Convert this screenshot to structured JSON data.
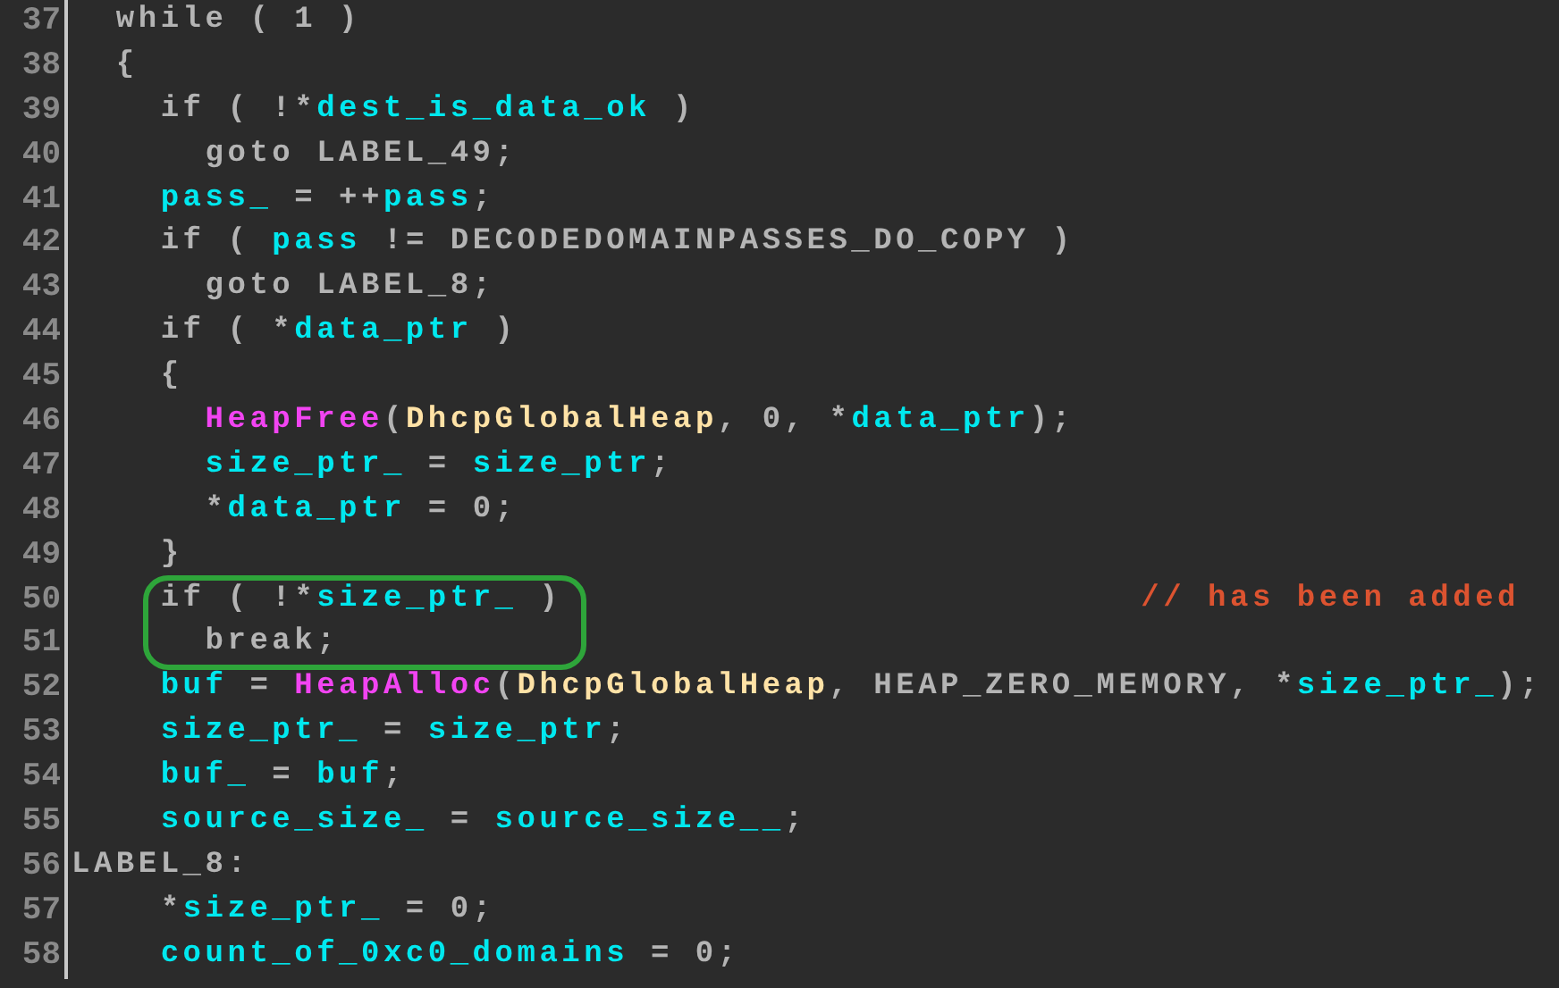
{
  "code_view": {
    "lines": [
      {
        "number": "37",
        "circled": false,
        "tokens": [
          {
            "kind": "plain",
            "text": "  while ( 1 )"
          }
        ]
      },
      {
        "number": "38",
        "circled": false,
        "tokens": [
          {
            "kind": "plain",
            "text": "  {"
          }
        ]
      },
      {
        "number": "39",
        "circled": false,
        "tokens": [
          {
            "kind": "plain",
            "text": "    if ( !*"
          },
          {
            "kind": "variable",
            "text": "dest_is_data_ok"
          },
          {
            "kind": "plain",
            "text": " )"
          }
        ]
      },
      {
        "number": "40",
        "circled": false,
        "tokens": [
          {
            "kind": "plain",
            "text": "      goto LABEL_49;"
          }
        ]
      },
      {
        "number": "41",
        "circled": false,
        "tokens": [
          {
            "kind": "variable",
            "text": "    pass_"
          },
          {
            "kind": "plain",
            "text": " = ++"
          },
          {
            "kind": "variable",
            "text": "pass"
          },
          {
            "kind": "plain",
            "text": ";"
          }
        ]
      },
      {
        "number": "42",
        "circled": false,
        "tokens": [
          {
            "kind": "plain",
            "text": "    if ( "
          },
          {
            "kind": "variable",
            "text": "pass"
          },
          {
            "kind": "plain",
            "text": " != DECODEDOMAINPASSES_DO_COPY )"
          }
        ]
      },
      {
        "number": "43",
        "circled": false,
        "tokens": [
          {
            "kind": "plain",
            "text": "      goto LABEL_8;"
          }
        ]
      },
      {
        "number": "44",
        "circled": false,
        "tokens": [
          {
            "kind": "plain",
            "text": "    if ( *"
          },
          {
            "kind": "variable",
            "text": "data_ptr"
          },
          {
            "kind": "plain",
            "text": " )"
          }
        ]
      },
      {
        "number": "45",
        "circled": false,
        "tokens": [
          {
            "kind": "plain",
            "text": "    {"
          }
        ]
      },
      {
        "number": "46",
        "circled": false,
        "tokens": [
          {
            "kind": "function",
            "text": "      HeapFree"
          },
          {
            "kind": "plain",
            "text": "("
          },
          {
            "kind": "global",
            "text": "DhcpGlobalHeap"
          },
          {
            "kind": "plain",
            "text": ", 0, *"
          },
          {
            "kind": "variable",
            "text": "data_ptr"
          },
          {
            "kind": "plain",
            "text": ");"
          }
        ]
      },
      {
        "number": "47",
        "circled": false,
        "tokens": [
          {
            "kind": "variable",
            "text": "      size_ptr_"
          },
          {
            "kind": "plain",
            "text": " = "
          },
          {
            "kind": "variable",
            "text": "size_ptr"
          },
          {
            "kind": "plain",
            "text": ";"
          }
        ]
      },
      {
        "number": "48",
        "circled": false,
        "tokens": [
          {
            "kind": "plain",
            "text": "      *"
          },
          {
            "kind": "variable",
            "text": "data_ptr"
          },
          {
            "kind": "plain",
            "text": " = 0;"
          }
        ]
      },
      {
        "number": "49",
        "circled": false,
        "tokens": [
          {
            "kind": "plain",
            "text": "    }"
          }
        ]
      },
      {
        "number": "50",
        "circled": true,
        "comment": "// has been added",
        "tokens": [
          {
            "kind": "plain",
            "text": "    if ( !*"
          },
          {
            "kind": "variable",
            "text": "size_ptr_"
          },
          {
            "kind": "plain",
            "text": " )"
          }
        ]
      },
      {
        "number": "51",
        "circled": true,
        "tokens": [
          {
            "kind": "plain",
            "text": "      break;"
          }
        ]
      },
      {
        "number": "52",
        "circled": false,
        "tokens": [
          {
            "kind": "variable",
            "text": "    buf"
          },
          {
            "kind": "plain",
            "text": " = "
          },
          {
            "kind": "function",
            "text": "HeapAlloc"
          },
          {
            "kind": "plain",
            "text": "("
          },
          {
            "kind": "global",
            "text": "DhcpGlobalHeap"
          },
          {
            "kind": "plain",
            "text": ", HEAP_ZERO_MEMORY, *"
          },
          {
            "kind": "variable",
            "text": "size_ptr_"
          },
          {
            "kind": "plain",
            "text": ");"
          }
        ]
      },
      {
        "number": "53",
        "circled": false,
        "tokens": [
          {
            "kind": "variable",
            "text": "    size_ptr_"
          },
          {
            "kind": "plain",
            "text": " = "
          },
          {
            "kind": "variable",
            "text": "size_ptr"
          },
          {
            "kind": "plain",
            "text": ";"
          }
        ]
      },
      {
        "number": "54",
        "circled": false,
        "tokens": [
          {
            "kind": "variable",
            "text": "    buf_"
          },
          {
            "kind": "plain",
            "text": " = "
          },
          {
            "kind": "variable",
            "text": "buf"
          },
          {
            "kind": "plain",
            "text": ";"
          }
        ]
      },
      {
        "number": "55",
        "circled": false,
        "tokens": [
          {
            "kind": "variable",
            "text": "    source_size_"
          },
          {
            "kind": "plain",
            "text": " = "
          },
          {
            "kind": "variable",
            "text": "source_size__"
          },
          {
            "kind": "plain",
            "text": ";"
          }
        ]
      },
      {
        "number": "56",
        "circled": false,
        "tokens": [
          {
            "kind": "plain",
            "text": "LABEL_8:"
          }
        ]
      },
      {
        "number": "57",
        "circled": false,
        "tokens": [
          {
            "kind": "plain",
            "text": "    *"
          },
          {
            "kind": "variable",
            "text": "size_ptr_"
          },
          {
            "kind": "plain",
            "text": " = 0;"
          }
        ]
      },
      {
        "number": "58",
        "circled": false,
        "tokens": [
          {
            "kind": "variable",
            "text": "    count_of_0xc0_domains"
          },
          {
            "kind": "plain",
            "text": " = 0;"
          }
        ]
      }
    ]
  }
}
